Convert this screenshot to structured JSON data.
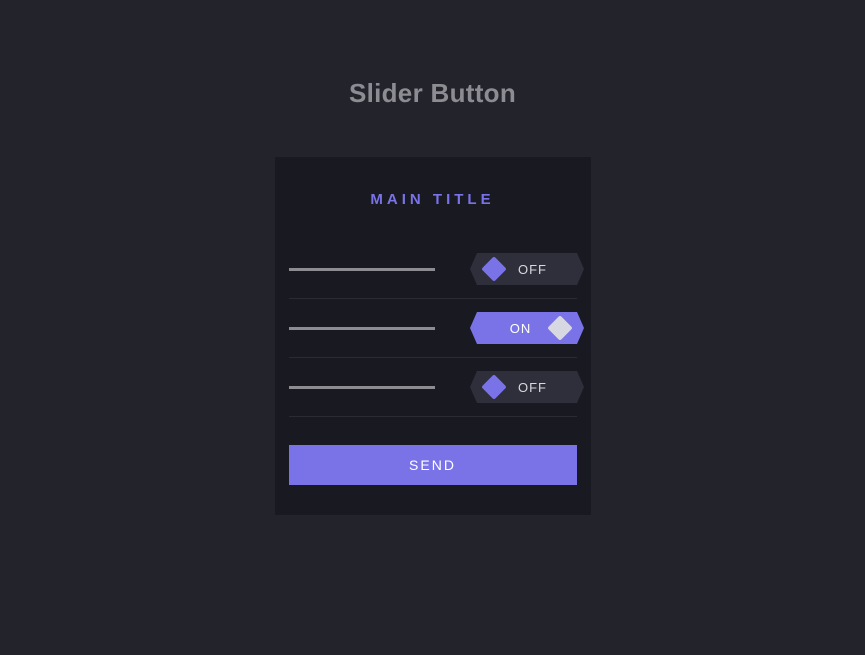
{
  "page": {
    "title": "Slider Button"
  },
  "card": {
    "title": "MAIN TITLE",
    "rows": [
      {
        "state": "off",
        "label": "OFF"
      },
      {
        "state": "on",
        "label": "ON"
      },
      {
        "state": "off",
        "label": "OFF"
      }
    ],
    "send_label": "SEND"
  },
  "colors": {
    "accent": "#7a73e8",
    "page_bg": "#22232b",
    "card_bg": "#191a21",
    "toggle_off_bg": "#2e2f3b",
    "knob_on": "#d8d8e2",
    "text_muted": "#8c8c92"
  }
}
